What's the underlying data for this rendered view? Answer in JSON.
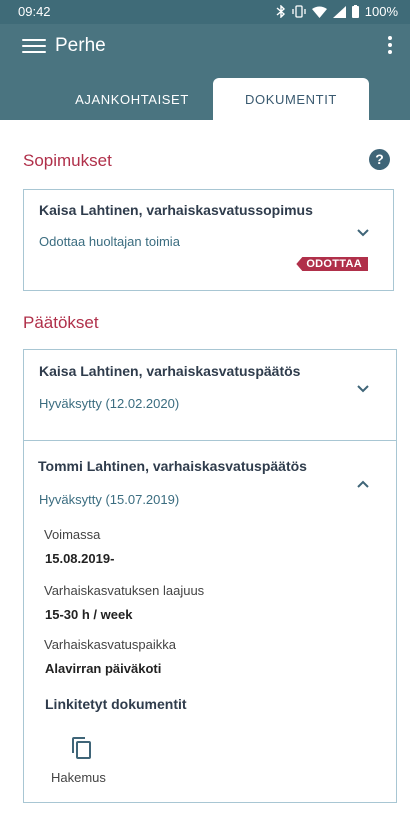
{
  "status_bar": {
    "time": "09:42",
    "battery": "100%"
  },
  "app_bar": {
    "title": "Perhe"
  },
  "tabs": [
    {
      "label": "AJANKOHTAISET",
      "active": false
    },
    {
      "label": "DOKUMENTIT",
      "active": true
    }
  ],
  "sopimukset": {
    "heading": "Sopimukset",
    "cards": [
      {
        "title": "Kaisa Lahtinen, varhaiskasvatussopimus",
        "status": "Odottaa huoltajan toimia",
        "badge": "ODOTTAA"
      }
    ]
  },
  "paatokset": {
    "heading": "Päätökset",
    "cards": [
      {
        "title": "Kaisa Lahtinen, varhaiskasvatuspäätös",
        "status": "Hyväksytty (12.02.2020)"
      },
      {
        "title": "Tommi Lahtinen, varhaiskasvatuspäätös",
        "status": "Hyväksytty (15.07.2019)",
        "details": [
          {
            "label": "Voimassa",
            "value": "15.08.2019-"
          },
          {
            "label": "Varhaiskasvatuksen laajuus",
            "value": "15-30 h / week"
          },
          {
            "label": "Varhaiskasvatuspaikka",
            "value": "Alavirran päiväkoti"
          }
        ],
        "linked_title": "Linkitetyt dokumentit",
        "linked_docs": [
          {
            "label": "Hakemus",
            "icon": "copy-document-icon"
          }
        ]
      }
    ]
  },
  "colors": {
    "header": "#4a7480",
    "accent": "#b0304a",
    "border": "#a8c6d3"
  }
}
